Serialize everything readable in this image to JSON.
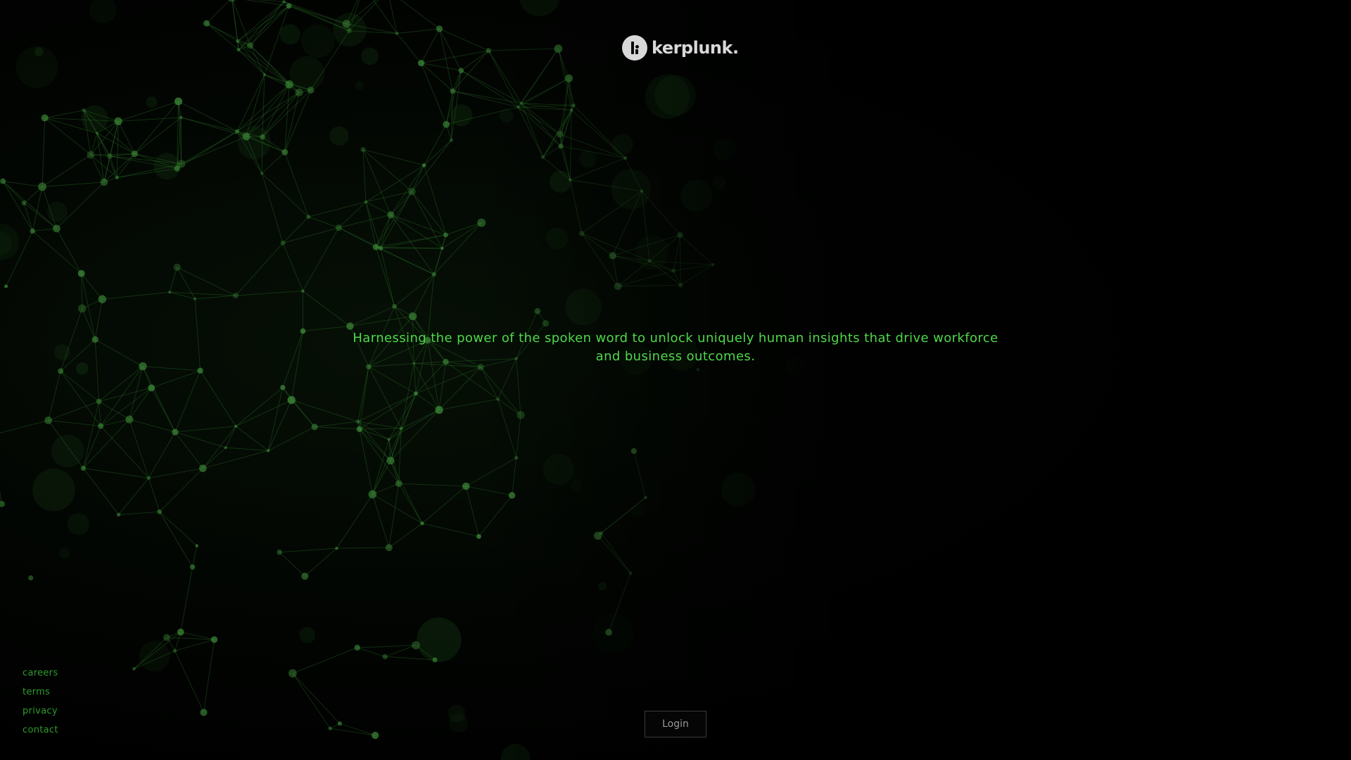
{
  "brand": {
    "name": "kerplunk.",
    "logo_icon": "kerplunk-k-logo-icon"
  },
  "hero": {
    "tagline_line1": "Harnessing the power of the spoken word to unlock uniquely human insights that drive workforce",
    "tagline_line2": "and business outcomes."
  },
  "footer": {
    "links": [
      "careers",
      "terms",
      "privacy",
      "contact"
    ]
  },
  "login": {
    "label": "Login"
  },
  "colors": {
    "background": "#000000",
    "accent_green": "#4fd84a",
    "link_green": "#2f9a2c",
    "logo_gray": "#d8d8d8",
    "button_border": "#3a3a3a",
    "network_green": "#2e7a2a"
  }
}
